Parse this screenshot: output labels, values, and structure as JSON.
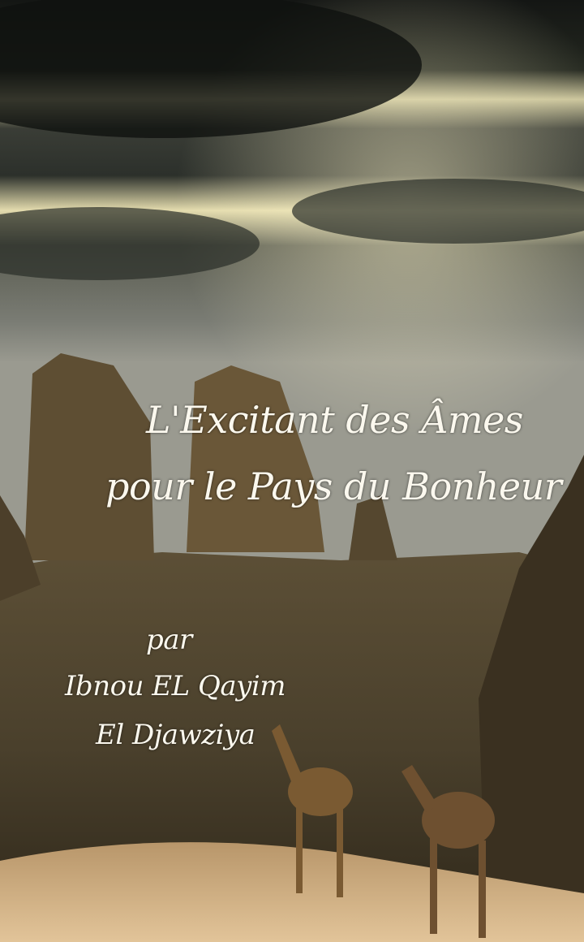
{
  "cover": {
    "title_line1": "L'Excitant des Âmes",
    "title_line2": "pour le Pays du Bonheur",
    "by": "par",
    "author_line1": "Ibnou EL Qayim",
    "author_line2": "El Djawziya"
  },
  "colors": {
    "text": "#fbf8ee",
    "sky_dark": "#1c1f1d",
    "sky_light": "#e8e2b8",
    "rock": "#6b5a3e",
    "sand": "#d9b88a"
  }
}
